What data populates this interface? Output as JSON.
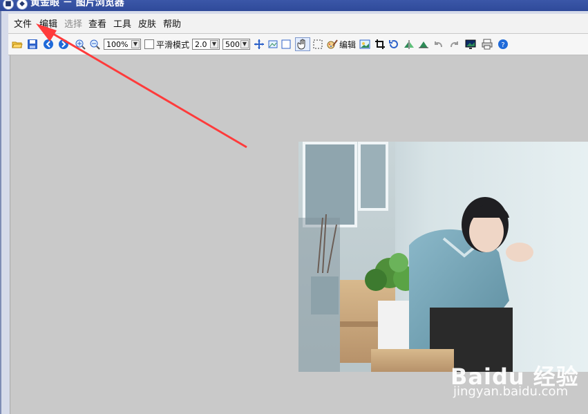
{
  "titlebar": {
    "title": "黄金眼 － 图片浏览器",
    "btn1": "■",
    "btn2": "◆"
  },
  "menu": {
    "items": [
      "文件",
      "编辑",
      "选择",
      "查看",
      "工具",
      "皮肤",
      "帮助"
    ]
  },
  "toolbar": {
    "zoom_value": "100%",
    "smooth_label": "平滑模式",
    "scale_value": "2.0",
    "size_value": "500",
    "edit_label": "编辑"
  },
  "watermark": {
    "main": "Baidu 经验",
    "sub": "jingyan.baidu.com"
  },
  "colors": {
    "title_blue": "#2f4a9a",
    "annotation_red": "#ff3b3b",
    "viewer_gray": "#c9c9c9"
  },
  "icons": [
    "open-folder-icon",
    "save-icon",
    "prev-icon",
    "next-icon",
    "zoom-in-icon",
    "zoom-out-icon",
    "fit-icon",
    "actual-size-icon",
    "fullscreen-icon",
    "hand-icon",
    "select-rect-icon",
    "edit-icon",
    "slideshow-icon",
    "crop-icon",
    "rotate-icon",
    "flip-h-icon",
    "flip-v-icon",
    "undo-icon",
    "redo-icon",
    "wallpaper-icon",
    "print-icon",
    "help-icon"
  ]
}
